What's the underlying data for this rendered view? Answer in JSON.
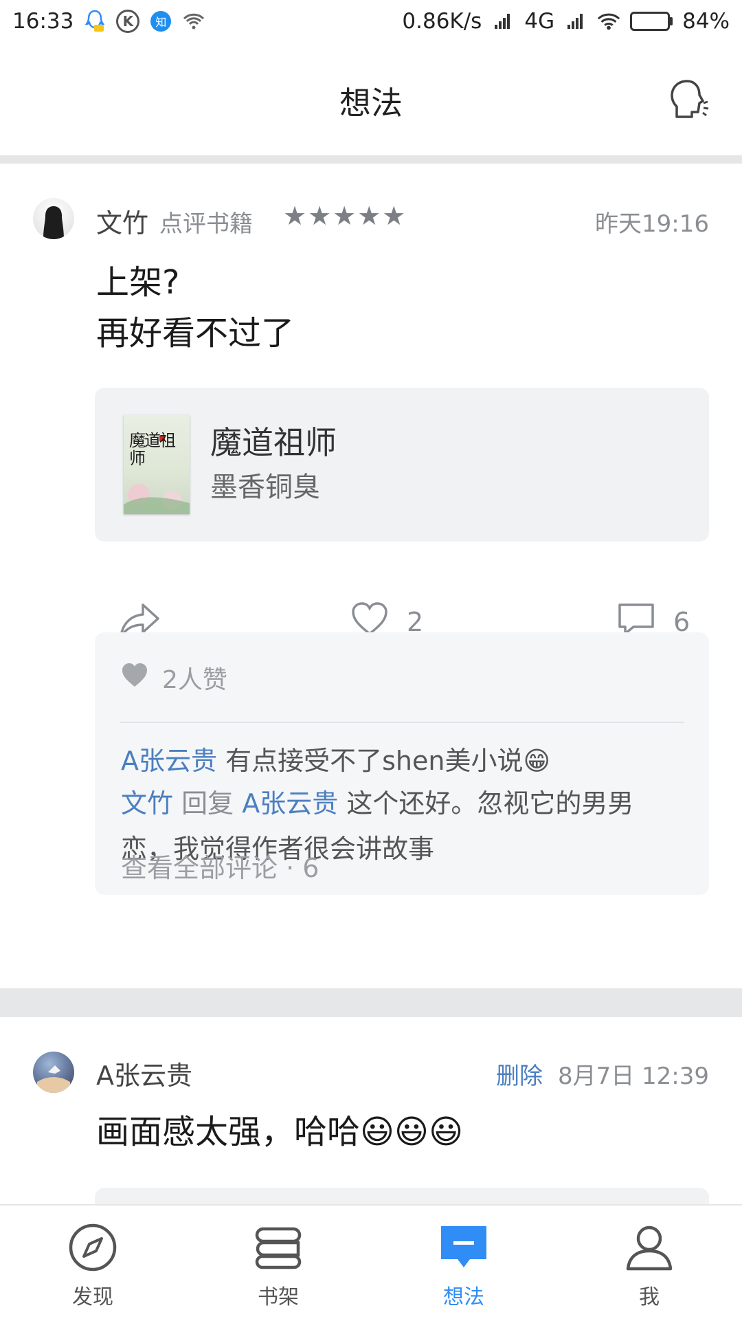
{
  "status_bar": {
    "time": "16:33",
    "network_speed": "0.86K/s",
    "network_type": "4G",
    "battery_percent": "84%",
    "battery_level": 0.84,
    "icons": [
      "qq-icon",
      "k-app-icon",
      "zhihu-icon",
      "wifi-icon",
      "signal-icon",
      "wifi-icon",
      "battery-icon"
    ]
  },
  "header": {
    "title": "想法",
    "action_icon": "chat-head-icon"
  },
  "posts": [
    {
      "author": "文竹",
      "action": "点评书籍",
      "rating_stars": "★★★★★",
      "rating": 5,
      "time": "昨天19:16",
      "text_lines": [
        "上架?",
        "再好看不过了"
      ],
      "book": {
        "title": "魔道祖师",
        "author": "墨香铜臭",
        "cover_text": "魔道祖师"
      },
      "actions": {
        "likes": "2",
        "comments": "6"
      },
      "likes_summary": "2人赞",
      "comments": [
        {
          "user": "A张云贵",
          "text": "有点接受不了shen美小说😁"
        },
        {
          "user": "文竹",
          "reply_word": "回复",
          "reply_to": "A张云贵",
          "text": "这个还好。忽视它的男男",
          "text_cont": "恋，我觉得作者很会讲故事"
        }
      ],
      "see_all": "查看全部评论 · 6"
    },
    {
      "author": "A张云贵",
      "delete_label": "删除",
      "time": "8月7日 12:39",
      "text": "画面感太强，哈哈😃😃😃"
    }
  ],
  "bottom_nav": [
    {
      "label": "发现",
      "icon": "compass-icon",
      "active": false
    },
    {
      "label": "书架",
      "icon": "bookshelf-icon",
      "active": false
    },
    {
      "label": "想法",
      "icon": "thoughts-icon",
      "active": true
    },
    {
      "label": "我",
      "icon": "profile-icon",
      "active": false
    }
  ],
  "colors": {
    "accent": "#2f8df5",
    "link": "#4b7fbf",
    "muted": "#8a8e93"
  }
}
